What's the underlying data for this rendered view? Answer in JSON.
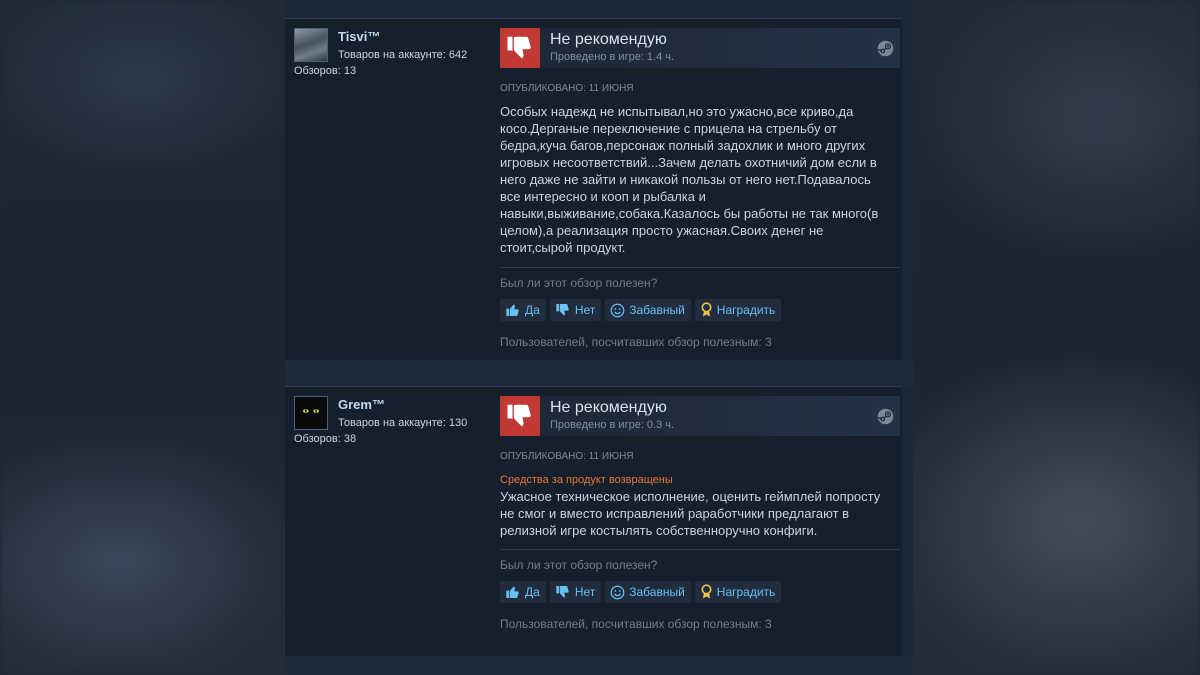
{
  "reviews": [
    {
      "author": {
        "name": "Tisvi™",
        "products": "Товаров на аккаунте: 642",
        "reviews": "Обзоров: 13"
      },
      "verdict": "Не рекомендую",
      "hours": "Проведено в игре: 1.4 ч.",
      "posted": "ОПУБЛИКОВАНО: 11 ИЮНЯ",
      "refunded": "",
      "body": "Особых надежд не испытывал,но это ужасно,все криво,да косо.Дерганые переключение с прицела на стрельбу от бедра,куча багов,персонаж полный задохлик и много других игровых несоответствий...Зачем делать охотничий дом если в него даже не зайти и никакой пользы от него нет.Подавалось все интересно и кооп и рыбалка и навыки,выживание,собака.Казалось бы работы не так много(в целом),а реализация просто ужасная.Своих денег не стоит,сырой продукт.",
      "helpful_question": "Был ли этот обзор полезен?",
      "buttons": {
        "yes": "Да",
        "no": "Нет",
        "funny": "Забавный",
        "award": "Наградить"
      },
      "helpful_count": "Пользователей, посчитавших обзор полезным: 3"
    },
    {
      "author": {
        "name": "Grem™",
        "products": "Товаров на аккаунте: 130",
        "reviews": "Обзоров: 38"
      },
      "verdict": "Не рекомендую",
      "hours": "Проведено в игре: 0.3 ч.",
      "posted": "ОПУБЛИКОВАНО: 11 ИЮНЯ",
      "refunded": "Средства за продукт возвращены",
      "body": "Ужасное техническое исполнение, оценить геймплей попросту не смог и вместо исправлений раработчики предлагают в релизной игре костылять собственноручно конфиги.",
      "helpful_question": "Был ли этот обзор полезен?",
      "buttons": {
        "yes": "Да",
        "no": "Нет",
        "funny": "Забавный",
        "award": "Наградить"
      },
      "helpful_count": "Пользователей, посчитавших обзор полезным: 3"
    }
  ],
  "icons": {
    "verdict": "thumbs-down-icon",
    "platform": "steam-icon",
    "yes": "thumbs-up-icon",
    "no": "thumbs-down-icon",
    "funny": "smiley-icon",
    "award": "award-icon"
  },
  "colors": {
    "verdict_red": "#c03934",
    "link_blue": "#67c1f5",
    "refund_orange": "#e5763d",
    "author_blue": "#c1dbf4"
  }
}
